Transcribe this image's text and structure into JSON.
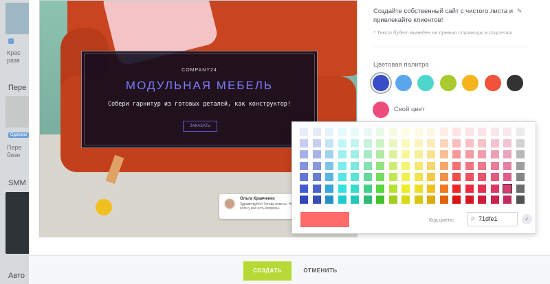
{
  "sidebar": {
    "items": [
      {
        "text": "Крас",
        "sub": "разв"
      },
      {
        "heading": "Пере"
      },
      {
        "text": "Пере",
        "sub": "бизн",
        "badge": "Сделано"
      },
      {
        "heading": "SMM"
      },
      {
        "heading": "Авто"
      }
    ]
  },
  "preview": {
    "brand": "COMPANY24",
    "title": "МОДУЛЬНАЯ МЕБЕЛЬ",
    "subtitle": "Собери гарнитур из готовых деталей, как конструктор!",
    "button": "ЗАКАЗАТЬ",
    "chat": {
      "name": "Ольга Кравченко",
      "text": "Здравствуйте! Готова помочь. Напишите мне, если у вас есть вопросы."
    }
  },
  "settings": {
    "description": "Создайте собственный сайт с чистого листа и привлекайте клиентов!",
    "hint": "* Текст будет выведен на превью страницы в соцсетях",
    "palette_title": "Цветовая палитра",
    "palette": [
      {
        "color": "#3a4cc6",
        "name": "palette-blue",
        "selected": true
      },
      {
        "color": "#5aa7ee",
        "name": "palette-light-blue",
        "selected": false
      },
      {
        "color": "#4fd6cc",
        "name": "palette-teal",
        "selected": false
      },
      {
        "color": "#a8cb2f",
        "name": "palette-green",
        "selected": false
      },
      {
        "color": "#f6b41c",
        "name": "palette-yellow",
        "selected": false
      },
      {
        "color": "#f0523a",
        "name": "palette-red",
        "selected": false
      },
      {
        "color": "#333333",
        "name": "palette-black",
        "selected": false
      }
    ],
    "own_color_label": "Свой цвет",
    "own_color": "#ee4c7c"
  },
  "picker": {
    "code_label": "Код цвета:",
    "hash": "#",
    "code_value": "71dfe1",
    "preview_color": "#ff6a6a",
    "ok_icon": "check-icon"
  },
  "footer": {
    "create": "СОЗДАТЬ",
    "cancel": "ОТМЕНИТЬ"
  }
}
